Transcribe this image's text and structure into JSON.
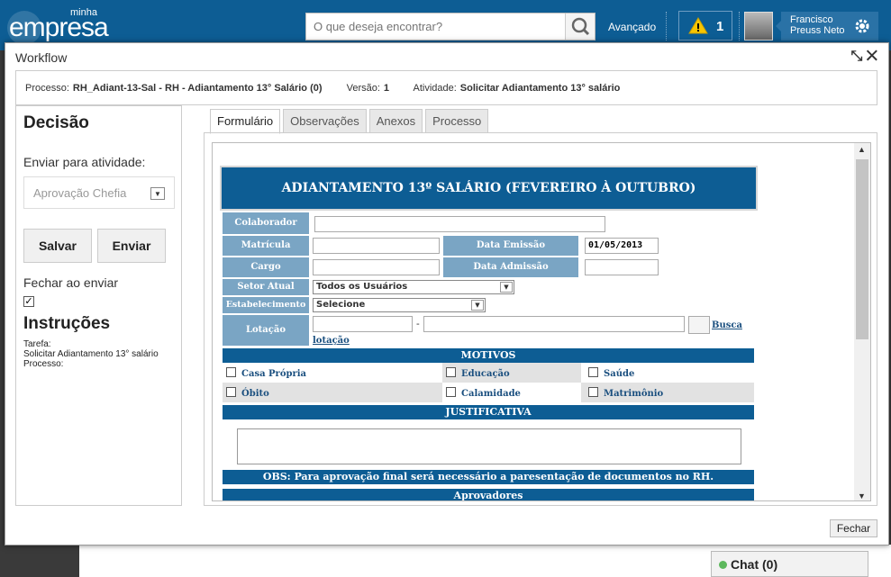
{
  "header": {
    "logo_small": "minha",
    "logo_main": "empresa",
    "search_placeholder": "O que deseja encontrar?",
    "advanced_label": "Avançado",
    "alert_count": "1",
    "user_name_line1": "Francisco",
    "user_name_line2": "Preuss Neto",
    "brand_color": "#0d5d94"
  },
  "modal": {
    "title": "Workflow",
    "info": {
      "processo_label": "Processo:",
      "processo_value": "RH_Adiant-13-Sal - RH - Adiantamento 13° Salário (0)",
      "versao_label": "Versão:",
      "versao_value": "1",
      "atividade_label": "Atividade:",
      "atividade_value": "Solicitar Adiantamento 13° salário"
    },
    "close_button": "Fechar"
  },
  "left_panel": {
    "title": "Decisão",
    "send_label": "Enviar para atividade:",
    "send_select_value": "Aprovação Chefia",
    "save_button": "Salvar",
    "send_button": "Enviar",
    "close_on_send_label": "Fechar ao enviar",
    "close_on_send_checked": true,
    "instructions_title": "Instruções",
    "task_label": "Tarefa:",
    "task_value": "Solicitar Adiantamento 13° salário",
    "process_label": "Processo:"
  },
  "tabs": [
    "Formulário",
    "Observações",
    "Anexos",
    "Processo"
  ],
  "form": {
    "title": "ADIANTAMENTO 13º SALÁRIO (FEVEREIRO À OUTUBRO)",
    "colaborador_label": "Colaborador",
    "matricula_label": "Matrícula",
    "data_emissao_label": "Data Emissão",
    "data_emissao_value": "01/05/2013",
    "cargo_label": "Cargo",
    "data_admissao_label": "Data Admissão",
    "setor_label": "Setor Atual",
    "setor_value": "Todos os Usuários",
    "estabelecimento_label": "Estabelecimento",
    "estabelecimento_value": "Selecione",
    "lotacao_label": "Lotação",
    "lotacao_dash": "-",
    "busca_link": "Busca lotação",
    "motivos_title": "MOTIVOS",
    "motivos": [
      "Casa Própria",
      "Educação",
      "Saúde",
      "Óbito",
      "Calamidade",
      "Matrimônio"
    ],
    "justificativa_title": "JUSTIFICATIVA",
    "obs_text": "OBS: Para aprovação final será necessário a paresentação de documentos no RH.",
    "aprovadores_title": "Aprovadores"
  },
  "chat": {
    "label": "Chat (0)"
  }
}
